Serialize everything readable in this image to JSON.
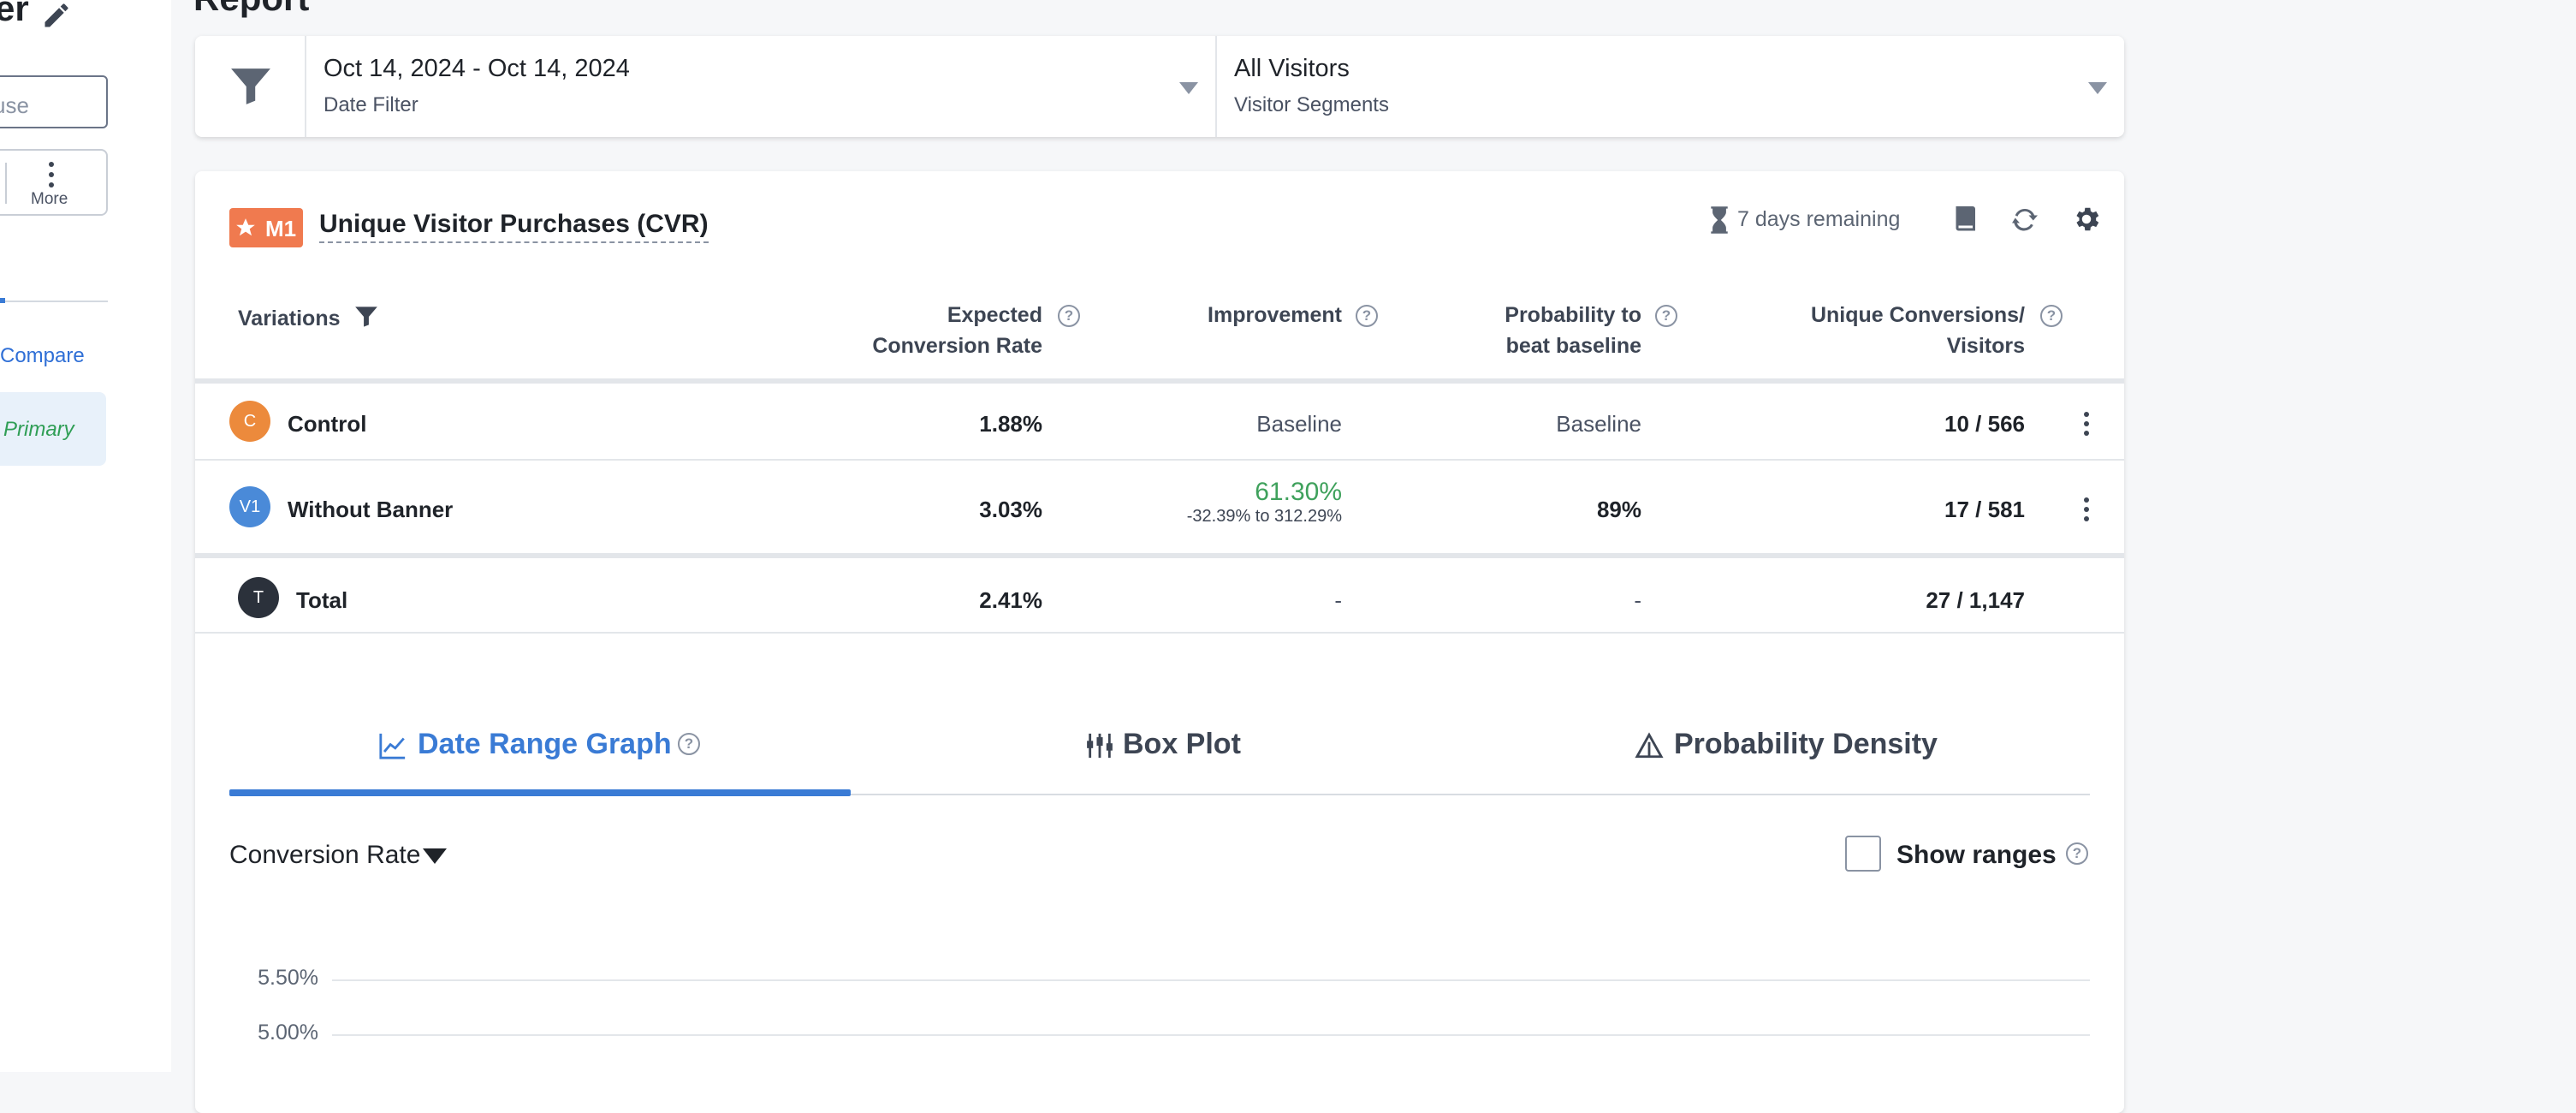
{
  "left_panel": {
    "title_fragment": "er",
    "input_value": "use",
    "more_label": "More",
    "compare_label": "Compare",
    "primary_label": "Primary"
  },
  "report_title": "Report",
  "filters": {
    "date_value": "Oct 14, 2024 - Oct 14, 2024",
    "date_label": "Date Filter",
    "segment_value": "All Visitors",
    "segment_label": "Visitor Segments"
  },
  "metric": {
    "badge": "M1",
    "title": "Unique Visitor Purchases (CVR)",
    "remaining": "7 days remaining",
    "icons": [
      "hourglass-icon",
      "book-icon",
      "refresh-icon",
      "gear-icon"
    ]
  },
  "table": {
    "headers": {
      "variations": "Variations",
      "expected_line1": "Expected",
      "expected_line2": "Conversion Rate",
      "improvement": "Improvement",
      "prob_line1": "Probability to",
      "prob_line2": "beat baseline",
      "conv_line1": "Unique Conversions/",
      "conv_line2": "Visitors"
    },
    "rows": [
      {
        "avatar": "C",
        "avatar_color": "#ec8a3c",
        "name": "Control",
        "cvr": "1.88%",
        "improvement": "Baseline",
        "probability": "Baseline",
        "conversions": "10 / 566"
      },
      {
        "avatar": "V1",
        "avatar_color": "#4a8ad8",
        "name": "Without Banner",
        "cvr": "3.03%",
        "improvement": "61.30%",
        "improvement_range": "-32.39% to 312.29%",
        "probability": "89%",
        "conversions": "17 / 581"
      }
    ],
    "total": {
      "avatar": "T",
      "avatar_color": "#2b313b",
      "name": "Total",
      "cvr": "2.41%",
      "improvement": "-",
      "probability": "-",
      "conversions": "27 / 1,147"
    }
  },
  "tabs": [
    {
      "label": "Date Range Graph",
      "icon": "line-chart-icon",
      "active": true
    },
    {
      "label": "Box Plot",
      "icon": "box-plot-icon",
      "active": false
    },
    {
      "label": "Probability Density",
      "icon": "density-icon",
      "active": false
    }
  ],
  "graph": {
    "metric_select": "Conversion Rate",
    "show_ranges_label": "Show ranges",
    "show_ranges_checked": false,
    "y_ticks": [
      "5.50%",
      "5.00%"
    ]
  },
  "colors": {
    "accent": "#3a7bd5",
    "positive": "#3fa15c",
    "badge": "#f07a4f"
  }
}
